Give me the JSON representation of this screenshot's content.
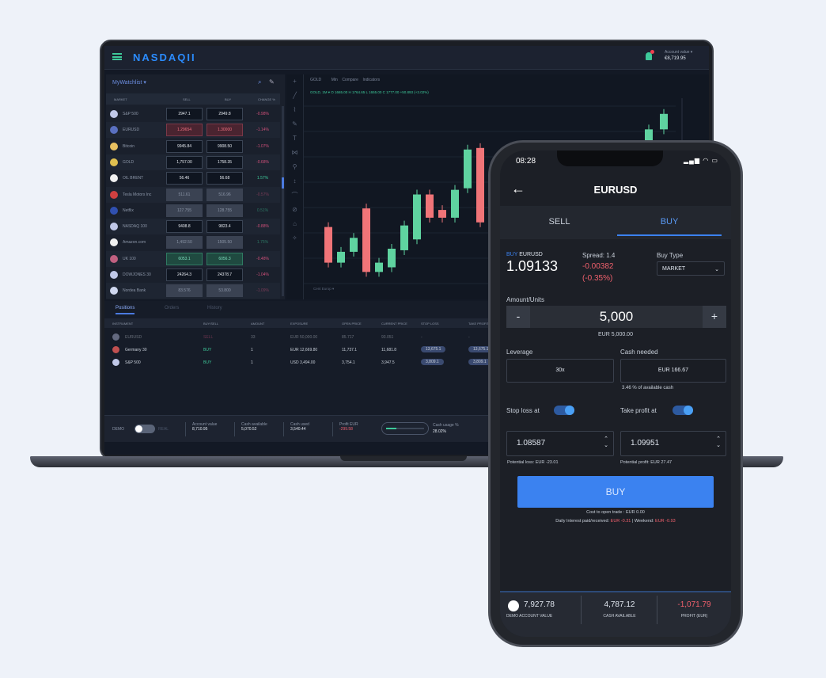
{
  "laptop": {
    "logo": "NASDAQII",
    "account_label": "Account value ▾",
    "account_value": "€8,719.95",
    "watchlist": {
      "title": "MyWatchlist ▾",
      "columns": [
        "MARKET",
        "SELL",
        "BUY",
        "CHANGE %"
      ],
      "rows": [
        {
          "name": "S&P 500",
          "sell": "2947.1",
          "buy": "2949.8",
          "change": "-0.98%",
          "flag": "#c0c8e8",
          "state": "normal"
        },
        {
          "name": "EURUSD",
          "sell": "1.29654",
          "buy": "1.30000",
          "change": "-1.14%",
          "flag": "#5a70c0",
          "state": "down"
        },
        {
          "name": "Bitcoin",
          "sell": "9945.84",
          "buy": "9908.50",
          "change": "-1.07%",
          "flag": "#e8c060",
          "state": "normal"
        },
        {
          "name": "GOLD",
          "sell": "1,757.00",
          "buy": "1758.35",
          "change": "-0.68%",
          "flag": "#e0c050",
          "state": "normal"
        },
        {
          "name": "OIL BRENT",
          "sell": "56.46",
          "buy": "56.68",
          "change": "1.57%",
          "flag": "#f0f0f0",
          "state": "normal"
        },
        {
          "name": "Tesla Motors Inc",
          "sell": "511.61",
          "buy": "516.96",
          "change": "-0.57%",
          "flag": "#d04040",
          "state": "muted"
        },
        {
          "name": "Netflix",
          "sell": "127.755",
          "buy": "128.755",
          "change": "0.51%",
          "flag": "#3050b0",
          "state": "muted"
        },
        {
          "name": "NASDAQ 100",
          "sell": "9408.8",
          "buy": "9823.4",
          "change": "-0.88%",
          "flag": "#c0c8e8",
          "state": "normal"
        },
        {
          "name": "Amazon.com",
          "sell": "1,492.50",
          "buy": "1505.50",
          "change": "1.75%",
          "flag": "#f0f0f0",
          "state": "muted"
        },
        {
          "name": "UK 100",
          "sell": "6053.1",
          "buy": "6056.3",
          "change": "-0.48%",
          "flag": "#c06080",
          "state": "up"
        },
        {
          "name": "DOWJONES 30",
          "sell": "24264.3",
          "buy": "24378.7",
          "change": "-1.04%",
          "flag": "#c0c8e8",
          "state": "normal"
        },
        {
          "name": "Nordea Bank",
          "sell": "83.576",
          "buy": "53.800",
          "change": "-1.09%",
          "flag": "#d0d8f0",
          "state": "muted"
        }
      ]
    },
    "chart": {
      "symbol": "GOLD",
      "interval": "Min",
      "compare": "Compare",
      "indicators": "Indicators",
      "ohlc": "GOLD, 1M ▾  O 1665.00  H 1764.65  L 1655.00  C 1777.00  +50.893 (+3.02%)",
      "footer": "Cent Europ ▾",
      "candles": [
        [
          1727,
          1704
        ],
        [
          1704,
          1711
        ],
        [
          1711,
          1720
        ],
        [
          1739,
          1698
        ],
        [
          1698,
          1704
        ],
        [
          1701,
          1713
        ],
        [
          1712,
          1728
        ],
        [
          1719,
          1748
        ],
        [
          1748,
          1733
        ],
        [
          1738,
          1733
        ],
        [
          1733,
          1751
        ],
        [
          1752,
          1777
        ],
        [
          1778,
          1730
        ]
      ],
      "recent_candles": [
        [
          1768,
          1778
        ],
        [
          1778,
          1790
        ],
        [
          1790,
          1800
        ]
      ],
      "up_color": "#5fd3a0",
      "down_color": "#f07478"
    },
    "positions": {
      "tabs": [
        "Positions",
        "Orders",
        "History"
      ],
      "columns": [
        "INSTRUMENT",
        "BUY/SELL",
        "AMOUNT",
        "EXPOSURE",
        "OPEN PRICE",
        "CURRENT PRICE",
        "STOP LOSS",
        "TAKE PROFIT"
      ],
      "rows": [
        {
          "name": "EURUSD",
          "side": "SELL",
          "amount": "33",
          "exposure": "EUR 50,000.00",
          "open": "85.717",
          "current": "93.051",
          "sl": "-",
          "tp": "-"
        },
        {
          "name": "Germany 30",
          "side": "BUY",
          "amount": "1",
          "exposure": "EUR 12,669.80",
          "open": "11,737.1",
          "current": "11,681.8",
          "sl": "13,675.1",
          "tp": "13,675.1"
        },
        {
          "name": "S&P 500",
          "side": "BUY",
          "amount": "1",
          "exposure": "USD 3,494.00",
          "open": "3,754.1",
          "current": "3,947.5",
          "sl": "3,809.1",
          "tp": "3,809.1"
        }
      ]
    },
    "bottom": {
      "demo": "DEMO",
      "real": "REAL",
      "stats": [
        {
          "label": "Account value",
          "value": "8,710.95"
        },
        {
          "label": "Cash available",
          "value": "5,070.52"
        },
        {
          "label": "Cash used",
          "value": "3,540.44"
        },
        {
          "label": "Profit EUR",
          "value": "-299.58"
        }
      ],
      "usage_label": "Cash usage %",
      "usage_value": "28.02%",
      "usage_fraction": 0.28
    }
  },
  "phone": {
    "time": "08:28",
    "title": "EURUSD",
    "tabs": [
      "SELL",
      "BUY"
    ],
    "active_tab": "BUY",
    "side": "BUY",
    "pair": "EURUSD",
    "price": "1.09133",
    "spread": "Spread: 1.4",
    "change": "-0.00382",
    "change_pct": "(-0.35%)",
    "buy_type_label": "Buy Type",
    "buy_type": "MARKET",
    "amount_label": "Amount/Units",
    "amount": "5,000",
    "amount_minus": "-",
    "amount_plus": "+",
    "amount_eur": "EUR 5,000.00",
    "leverage_label": "Leverage",
    "leverage": "30x",
    "cash_needed_label": "Cash needed",
    "cash_needed": "EUR 166.67",
    "cash_pct": "3.46 % of available cash",
    "stop_loss_label": "Stop loss at",
    "stop_loss": "1.08587",
    "potential_loss": "Potential loss: EUR -23.01",
    "take_profit_label": "Take profit at",
    "take_profit": "1.09951",
    "potential_profit": "Potential profit: EUR 27.47",
    "buy_button": "BUY",
    "cost": "Cost to open trade : EUR 0.00",
    "interest_label": "Daily Interest paid/received:",
    "interest": "EUR -0.31",
    "sep": "|",
    "weekend_label": "Weekend:",
    "weekend": "EUR -0.93",
    "footer": [
      {
        "value": "7,927.78",
        "label": "DEMO ACCOUNT VALUE"
      },
      {
        "value": "4,787.12",
        "label": "CASH AVAILABLE"
      },
      {
        "value": "-1,071.79",
        "label": "PROFIT (EUR)"
      }
    ],
    "accent": "#3b82f0"
  }
}
